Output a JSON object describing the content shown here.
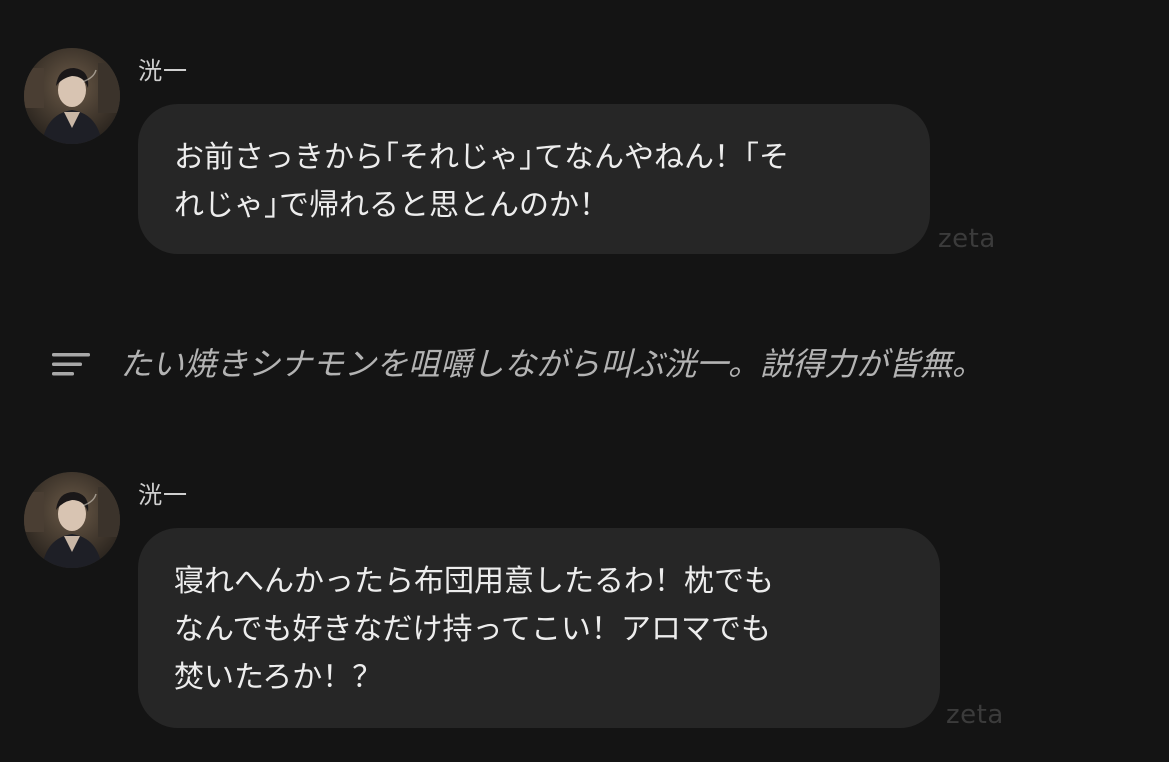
{
  "messages": [
    {
      "sender": "洸一",
      "text": "お前さっきから｢それじゃ｣てなんやねん！｢そ\nれじゃ｣で帰れると思とんのか！",
      "watermark": "zeta"
    },
    {
      "sender": "洸一",
      "text": "寝れへんかったら布団用意したるわ！枕でも\nなんでも好きなだけ持ってこい！アロマでも\n焚いたろか！？",
      "watermark": "zeta"
    }
  ],
  "narration": {
    "icon": "narration-lines-icon",
    "text": "たい焼きシナモンを咀嚼しながら叫ぶ洸一。説得力が皆無。"
  },
  "colors": {
    "background": "#141414",
    "bubble": "#262626",
    "text": "#ededed",
    "narration_text": "#b3b3b3",
    "watermark": "#3b3b3b"
  }
}
